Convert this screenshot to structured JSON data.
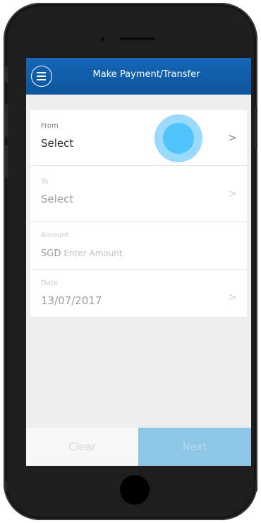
{
  "header": {
    "title": "Make Payment/Transfer",
    "menu_icon": "hamburger-menu-icon"
  },
  "form": {
    "from": {
      "label": "From",
      "value": "Select"
    },
    "to": {
      "label": "To",
      "value": "Select"
    },
    "amount": {
      "label": "Amount",
      "currency": "SGD",
      "placeholder": "Enter Amount"
    },
    "date": {
      "label": "Date",
      "value": "13/07/2017"
    },
    "chevron": ">"
  },
  "footer": {
    "clear_label": "Clear",
    "next_label": "Next"
  },
  "colors": {
    "header": "#0e5ba6",
    "touch_indicator": "#4ec4fb",
    "next_button": "#8ec6e6"
  }
}
